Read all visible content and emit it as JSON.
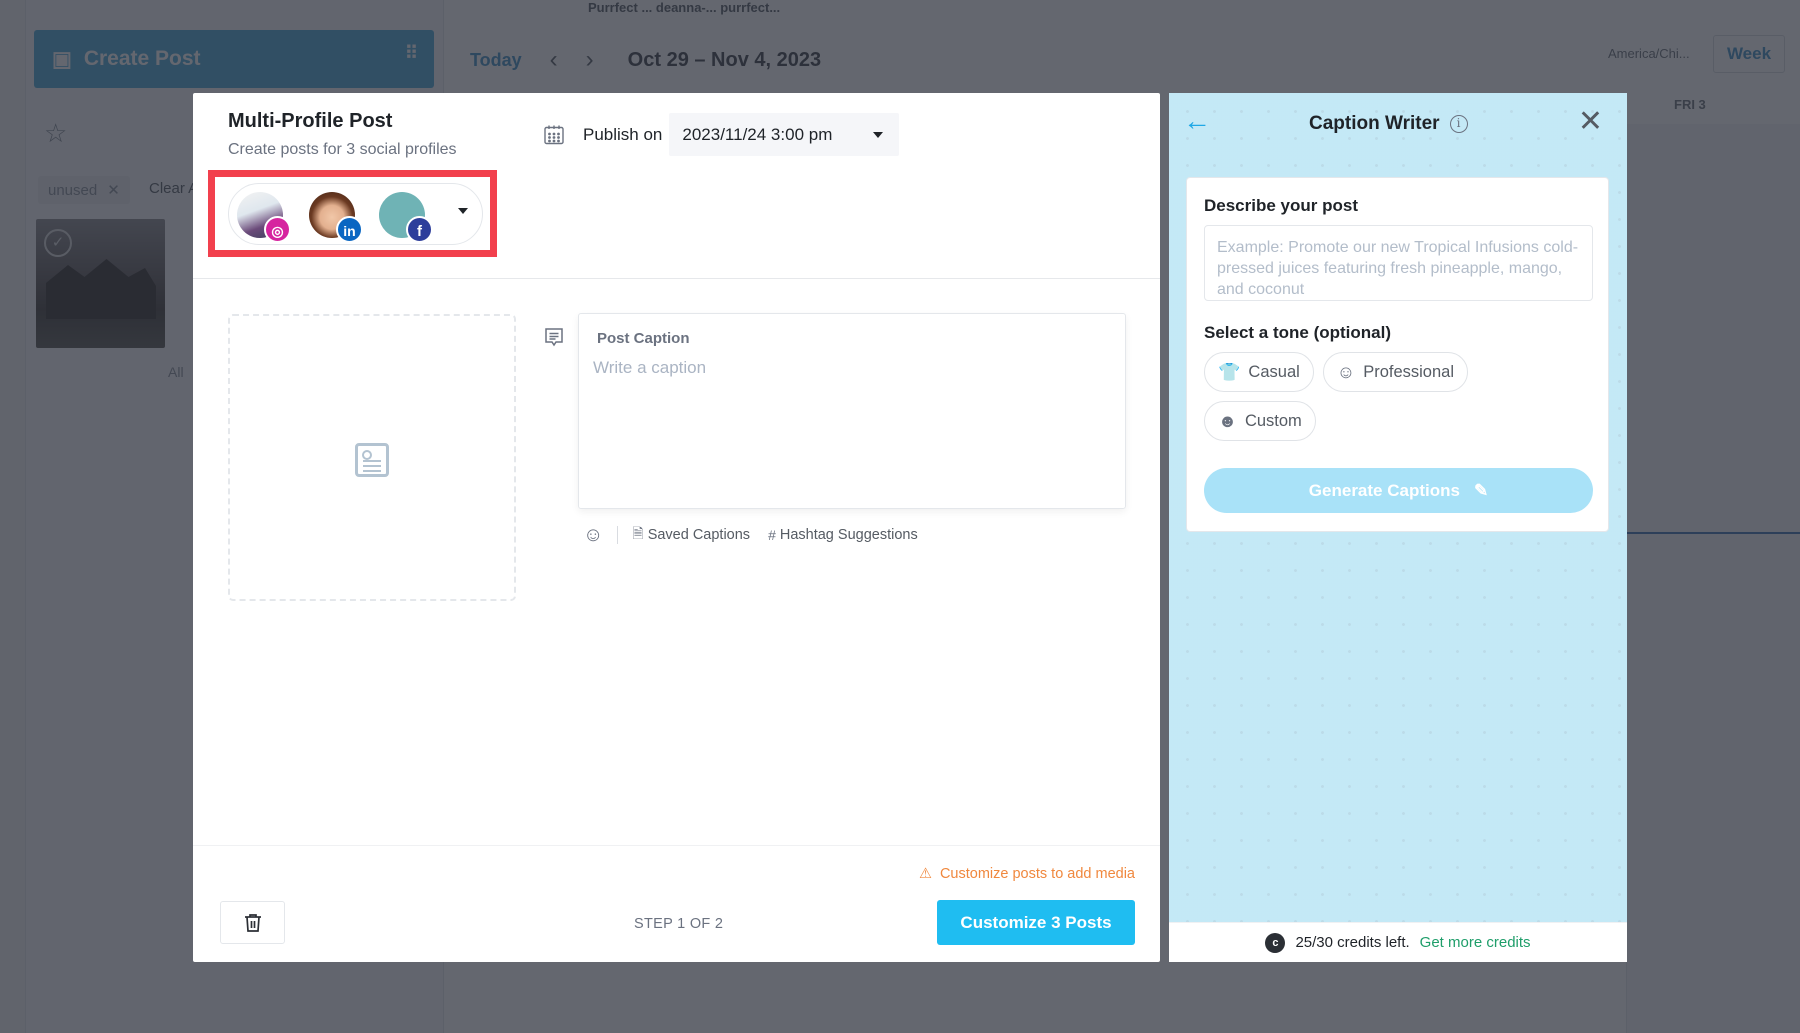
{
  "background": {
    "sidebar": {
      "create_post_label": "Create Post",
      "filter_chip": "unused",
      "clear_label": "Clear All",
      "all_label": "All"
    },
    "calendar": {
      "top_profiles": "Purrfect ... deanna-...  purrfect...",
      "today_label": "Today",
      "date_range": "Oct 29 – Nov 4, 2023",
      "timezone": "America/Chi...",
      "view_label": "Week",
      "day_label": "FRI 3"
    }
  },
  "modal": {
    "title": "Multi-Profile Post",
    "subtitle": "Create posts for 3 social profiles",
    "profiles": [
      {
        "network": "Instagram",
        "badge": "◎",
        "color": "#d6249f"
      },
      {
        "network": "LinkedIn",
        "badge": "in",
        "color": "#0a66c2"
      },
      {
        "network": "Facebook",
        "badge": "f",
        "color": "#2d3e9b"
      }
    ],
    "highlight_color": "#f2404d",
    "publish_label": "Publish on",
    "publish_value": "2023/11/24 3:00 pm",
    "caption_label": "Post Caption",
    "caption_placeholder": "Write a caption",
    "caption_value": "",
    "tools": {
      "saved_captions": "Saved Captions",
      "hashtag_suggestions": "Hashtag Suggestions"
    },
    "warning": "Customize posts to add media",
    "warning_color": "#f0883e",
    "step_label": "STEP 1 OF 2",
    "primary_button": "Customize 3 Posts",
    "accent_color": "#1fbdf1"
  },
  "caption_writer": {
    "title": "Caption Writer",
    "describe_label": "Describe your post",
    "describe_placeholder": "Example: Promote our new Tropical Infusions cold-pressed juices featuring fresh pineapple, mango, and coconut",
    "describe_value": "",
    "tone_label": "Select a tone (optional)",
    "tones": [
      {
        "label": "Casual",
        "icon": "shirt-icon"
      },
      {
        "label": "Professional",
        "icon": "bowtie-face-icon"
      },
      {
        "label": "Custom",
        "icon": "faces-icon"
      }
    ],
    "generate_label": "Generate Captions",
    "credits_used": 25,
    "credits_total": 30,
    "credits_text": "25/30 credits left.",
    "more_credits_link": "Get more credits"
  }
}
